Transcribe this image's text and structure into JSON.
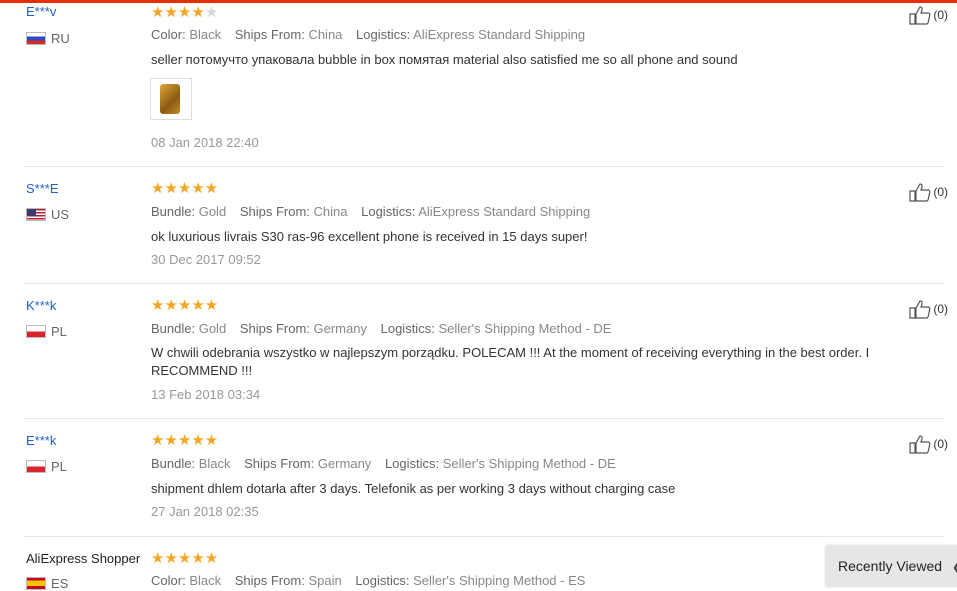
{
  "reviews": [
    {
      "user": "E***v",
      "country": "RU",
      "flag": "ru",
      "stars": 4,
      "attr1_label": "Color:",
      "attr1_value": "Black",
      "ships_label": "Ships From:",
      "ships_value": "China",
      "log_label": "Logistics:",
      "log_value": "AliExpress Standard Shipping",
      "text": "seller потомучто упаковала bubble in box помятая material also satisfied me so all phone and sound",
      "date": "08 Jan 2018 22:40",
      "likes": "(0)"
    },
    {
      "user": "S***E",
      "country": "US",
      "flag": "us",
      "stars": 5,
      "attr1_label": "Bundle:",
      "attr1_value": "Gold",
      "ships_label": "Ships From:",
      "ships_value": "China",
      "log_label": "Logistics:",
      "log_value": "AliExpress Standard Shipping",
      "text": "ok luxurious livrais S30 ras-96 excellent phone is received in 15 days super!",
      "date": "30 Dec 2017 09:52",
      "likes": "(0)"
    },
    {
      "user": "K***k",
      "country": "PL",
      "flag": "pl",
      "stars": 5,
      "attr1_label": "Bundle:",
      "attr1_value": "Gold",
      "ships_label": "Ships From:",
      "ships_value": "Germany",
      "log_label": "Logistics:",
      "log_value": "Seller's Shipping Method - DE",
      "text": "W chwili odebrania wszystko w najlepszym porządku. POLECAM !!! At the moment of receiving everything in the best order. I RECOMMEND !!!",
      "date": "13 Feb 2018 03:34",
      "likes": "(0)"
    },
    {
      "user": "E***k",
      "country": "PL",
      "flag": "pl",
      "stars": 5,
      "attr1_label": "Bundle:",
      "attr1_value": "Black",
      "ships_label": "Ships From:",
      "ships_value": "Germany",
      "log_label": "Logistics:",
      "log_value": "Seller's Shipping Method - DE",
      "text": "shipment dhlem dotarła after 3 days. Telefonik as per working 3 days without charging case",
      "date": "27 Jan 2018 02:35",
      "likes": "(0)"
    },
    {
      "user": "AliExpress Shopper",
      "country": "ES",
      "flag": "es",
      "stars": 5,
      "attr1_label": "Color:",
      "attr1_value": "Black",
      "ships_label": "Ships From:",
      "ships_value": "Spain",
      "log_label": "Logistics:",
      "log_value": "Seller's Shipping Method - ES"
    }
  ],
  "recently_viewed": "Recently Viewed",
  "colors": {
    "accent": "#e62e04",
    "star": "#f5a623",
    "link": "#2261c6"
  }
}
